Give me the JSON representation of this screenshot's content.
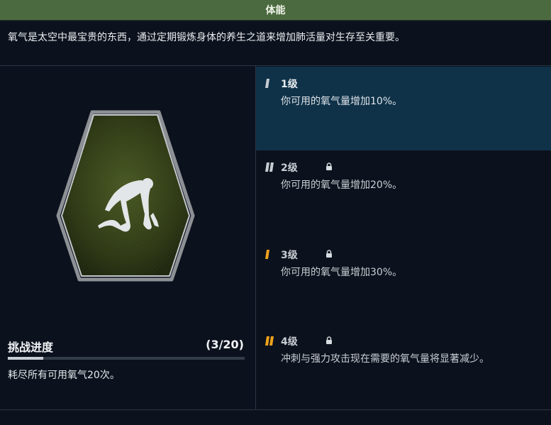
{
  "header": {
    "title": "体能"
  },
  "description": "氧气是太空中最宝贵的东西，通过定期锻炼身体的养生之道来增加肺活量对生存至关重要。",
  "colors": {
    "header_bg": "#4c6a3f",
    "panel_active": "#0f3249",
    "accent_gold": "#f0a21a",
    "badge_green": "#3b4a1e"
  },
  "badge": {
    "icon": "runner-crouch-icon"
  },
  "challenge": {
    "title": "挑战进度",
    "count": "(3/20)",
    "progress": 0.15,
    "description": "耗尽所有可用氧气20次。"
  },
  "levels": [
    {
      "label": "1级",
      "description": "你可用的氧气量增加10%。",
      "locked": false,
      "active": true,
      "mark_color": "#c8ccd3"
    },
    {
      "label": "2级",
      "description": "你可用的氧气量增加20%。",
      "locked": true,
      "active": false,
      "mark_color": "#c8ccd3"
    },
    {
      "label": "3级",
      "description": "你可用的氧气量增加30%。",
      "locked": true,
      "active": false,
      "mark_color": "#f0a21a"
    },
    {
      "label": "4级",
      "description": "冲刺与强力攻击现在需要的氧气量将显著减少。",
      "locked": true,
      "active": false,
      "mark_color": "#f0a21a"
    }
  ]
}
